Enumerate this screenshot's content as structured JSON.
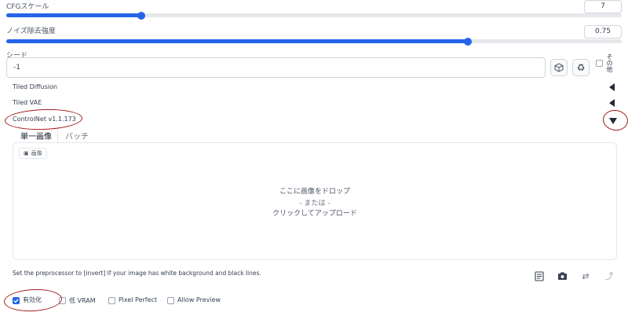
{
  "cfg": {
    "label": "CFGスケール",
    "value": "7",
    "fraction": 0.22
  },
  "denoise": {
    "label": "ノイズ除去強度",
    "value": "0.75",
    "fraction": 0.75
  },
  "seed": {
    "label": "シード",
    "value": "-1",
    "dice_icon": "dice-icon",
    "recycle_icon": "recycle-icon",
    "extra_label": "その他",
    "extra_checked": false
  },
  "accordions": [
    {
      "label": "Tiled Diffusion",
      "state": "collapsed"
    },
    {
      "label": "Tiled VAE",
      "state": "collapsed"
    },
    {
      "label": "ControlNet v1.1.173",
      "state": "expanded"
    }
  ],
  "controlnet": {
    "tabs": [
      {
        "label": "単一画像",
        "active": true
      },
      {
        "label": "バッチ",
        "active": false
      }
    ],
    "image_chip": "画像",
    "drop": {
      "line1": "ここに画像をドロップ",
      "line2": "- または -",
      "line3": "クリックしてアップロード"
    },
    "hint": "Set the preprocessor to [invert] If your image has white background and black lines.",
    "tools": [
      "new-canvas-icon",
      "camera-icon",
      "swap-icon",
      "send-dimensions-icon"
    ],
    "checkboxes": [
      {
        "label": "有効化",
        "checked": true
      },
      {
        "label": "低 VRAM",
        "checked": false
      },
      {
        "label": "Pixel Perfect",
        "checked": false
      },
      {
        "label": "Allow Preview",
        "checked": false
      }
    ]
  },
  "colors": {
    "accent": "#2563eb",
    "annotation": "#a31d1d"
  }
}
